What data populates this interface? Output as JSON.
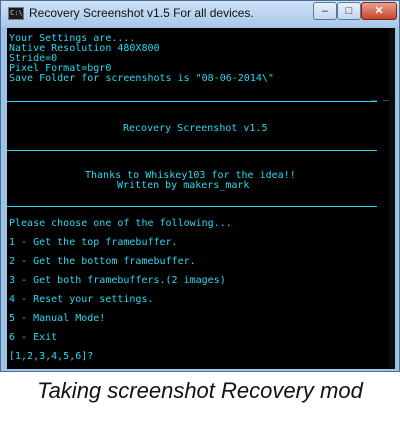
{
  "window": {
    "title": "Recovery Screenshot v1.5 For all devices.",
    "icon_text": "C:\\",
    "buttons": {
      "minimize": "–",
      "maximize": "□",
      "close": "✕"
    }
  },
  "console": {
    "settings": [
      "Your Settings are....",
      "Native Resolution 480X800",
      "Stride=0",
      "Pixel Format=bgr0",
      "Save Folder for screenshots is \"08-06-2014\\\""
    ],
    "separator_mark": "_ _",
    "header_title": "Recovery Screenshot v1.5",
    "credits": [
      "Thanks to Whiskey103 for the idea!!",
      "Written by makers_mark"
    ],
    "menu_prompt": "Please choose one of the following...",
    "options": [
      "1 - Get the top framebuffer.",
      "2 - Get the bottom framebuffer.",
      "3 - Get both framebuffers.(2 images)",
      "4 - Reset your settings.",
      "5 - Manual Mode!",
      "6 - Exit"
    ],
    "input_prompt": "[1,2,3,4,5,6]?"
  },
  "caption": "Taking screenshot Recovery mod",
  "colors": {
    "console_text": "#29d8f0",
    "console_bg": "#000000"
  }
}
